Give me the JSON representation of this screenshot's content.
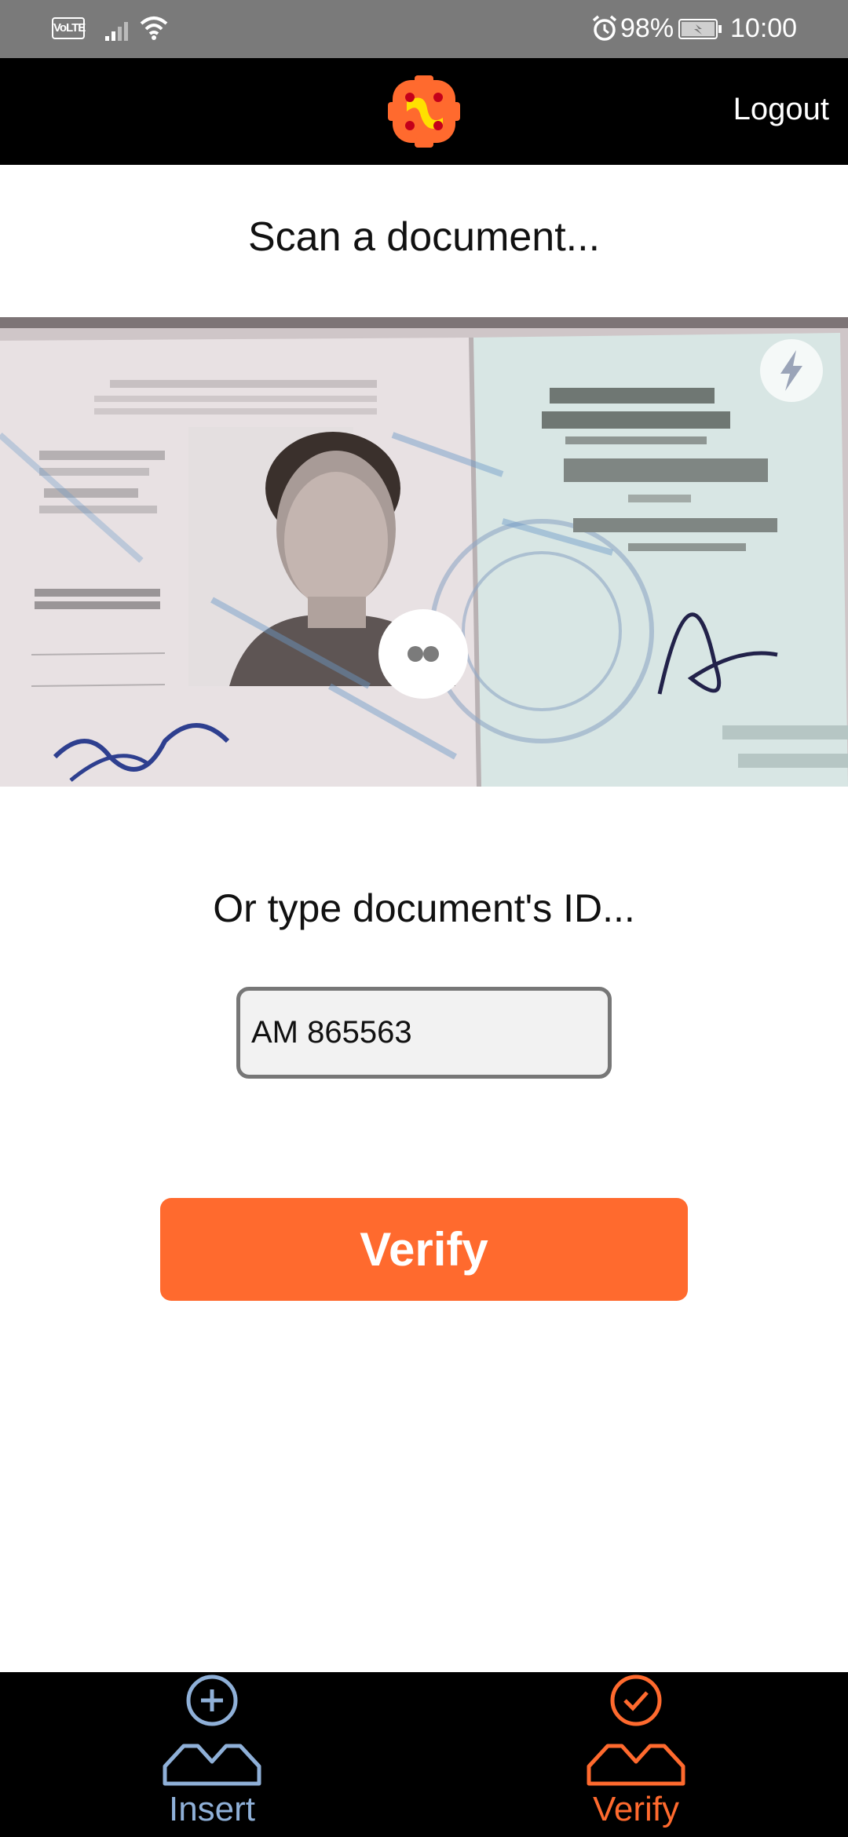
{
  "status_bar": {
    "network_badge": "VoLTE",
    "battery_percent": "98%",
    "time": "10:00",
    "icons": [
      "volte-icon",
      "signal-icon",
      "wifi-icon",
      "alarm-icon",
      "battery-charging-icon"
    ]
  },
  "header": {
    "logo_icon": "app-logo-icon",
    "logout_label": "Logout"
  },
  "scan": {
    "title": "Scan a document...",
    "flash_icon": "lightning-icon",
    "capture_icon": "camera-capture-icon"
  },
  "manual_entry": {
    "label": "Or type document's ID...",
    "value": "AM 865563"
  },
  "actions": {
    "verify_label": "Verify"
  },
  "bottom_nav": {
    "items": [
      {
        "label": "Insert",
        "icon": "user-add-icon",
        "active": false
      },
      {
        "label": "Verify",
        "icon": "user-check-icon",
        "active": true
      }
    ]
  },
  "colors": {
    "accent": "#ff6a2e",
    "header_bg": "#000000",
    "status_bar_bg": "#7a7a7a",
    "inactive_nav": "#8fb0d8"
  }
}
